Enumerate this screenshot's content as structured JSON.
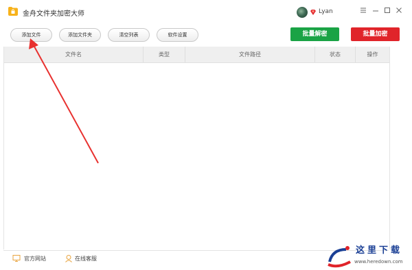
{
  "app": {
    "title": "金舟文件夹加密大师",
    "icon": "folder-lock-icon"
  },
  "user": {
    "name": "Lyan",
    "avatar": "avatar",
    "badge_icon": "vip-diamond-icon"
  },
  "window_controls": [
    "menu-icon",
    "minimize-icon",
    "maximize-icon",
    "close-icon"
  ],
  "toolbar": {
    "add_file": "添加文件",
    "add_folder": "添加文件夹",
    "clear_list": "清空列表",
    "settings": "软件设置",
    "batch_decrypt": "批量解密",
    "batch_encrypt": "批量加密"
  },
  "colors": {
    "decrypt": "#1aa345",
    "encrypt": "#e0242a",
    "arrow": "#e8312f",
    "watermark": "#1a3f95"
  },
  "table": {
    "columns": [
      "文件名",
      "类型",
      "文件路径",
      "状态",
      "操作"
    ],
    "rows": []
  },
  "statusbar": {
    "website": "官方网站",
    "support": "在线客服"
  },
  "watermark": {
    "text": "这里下载",
    "url": "www.heredown.com"
  }
}
